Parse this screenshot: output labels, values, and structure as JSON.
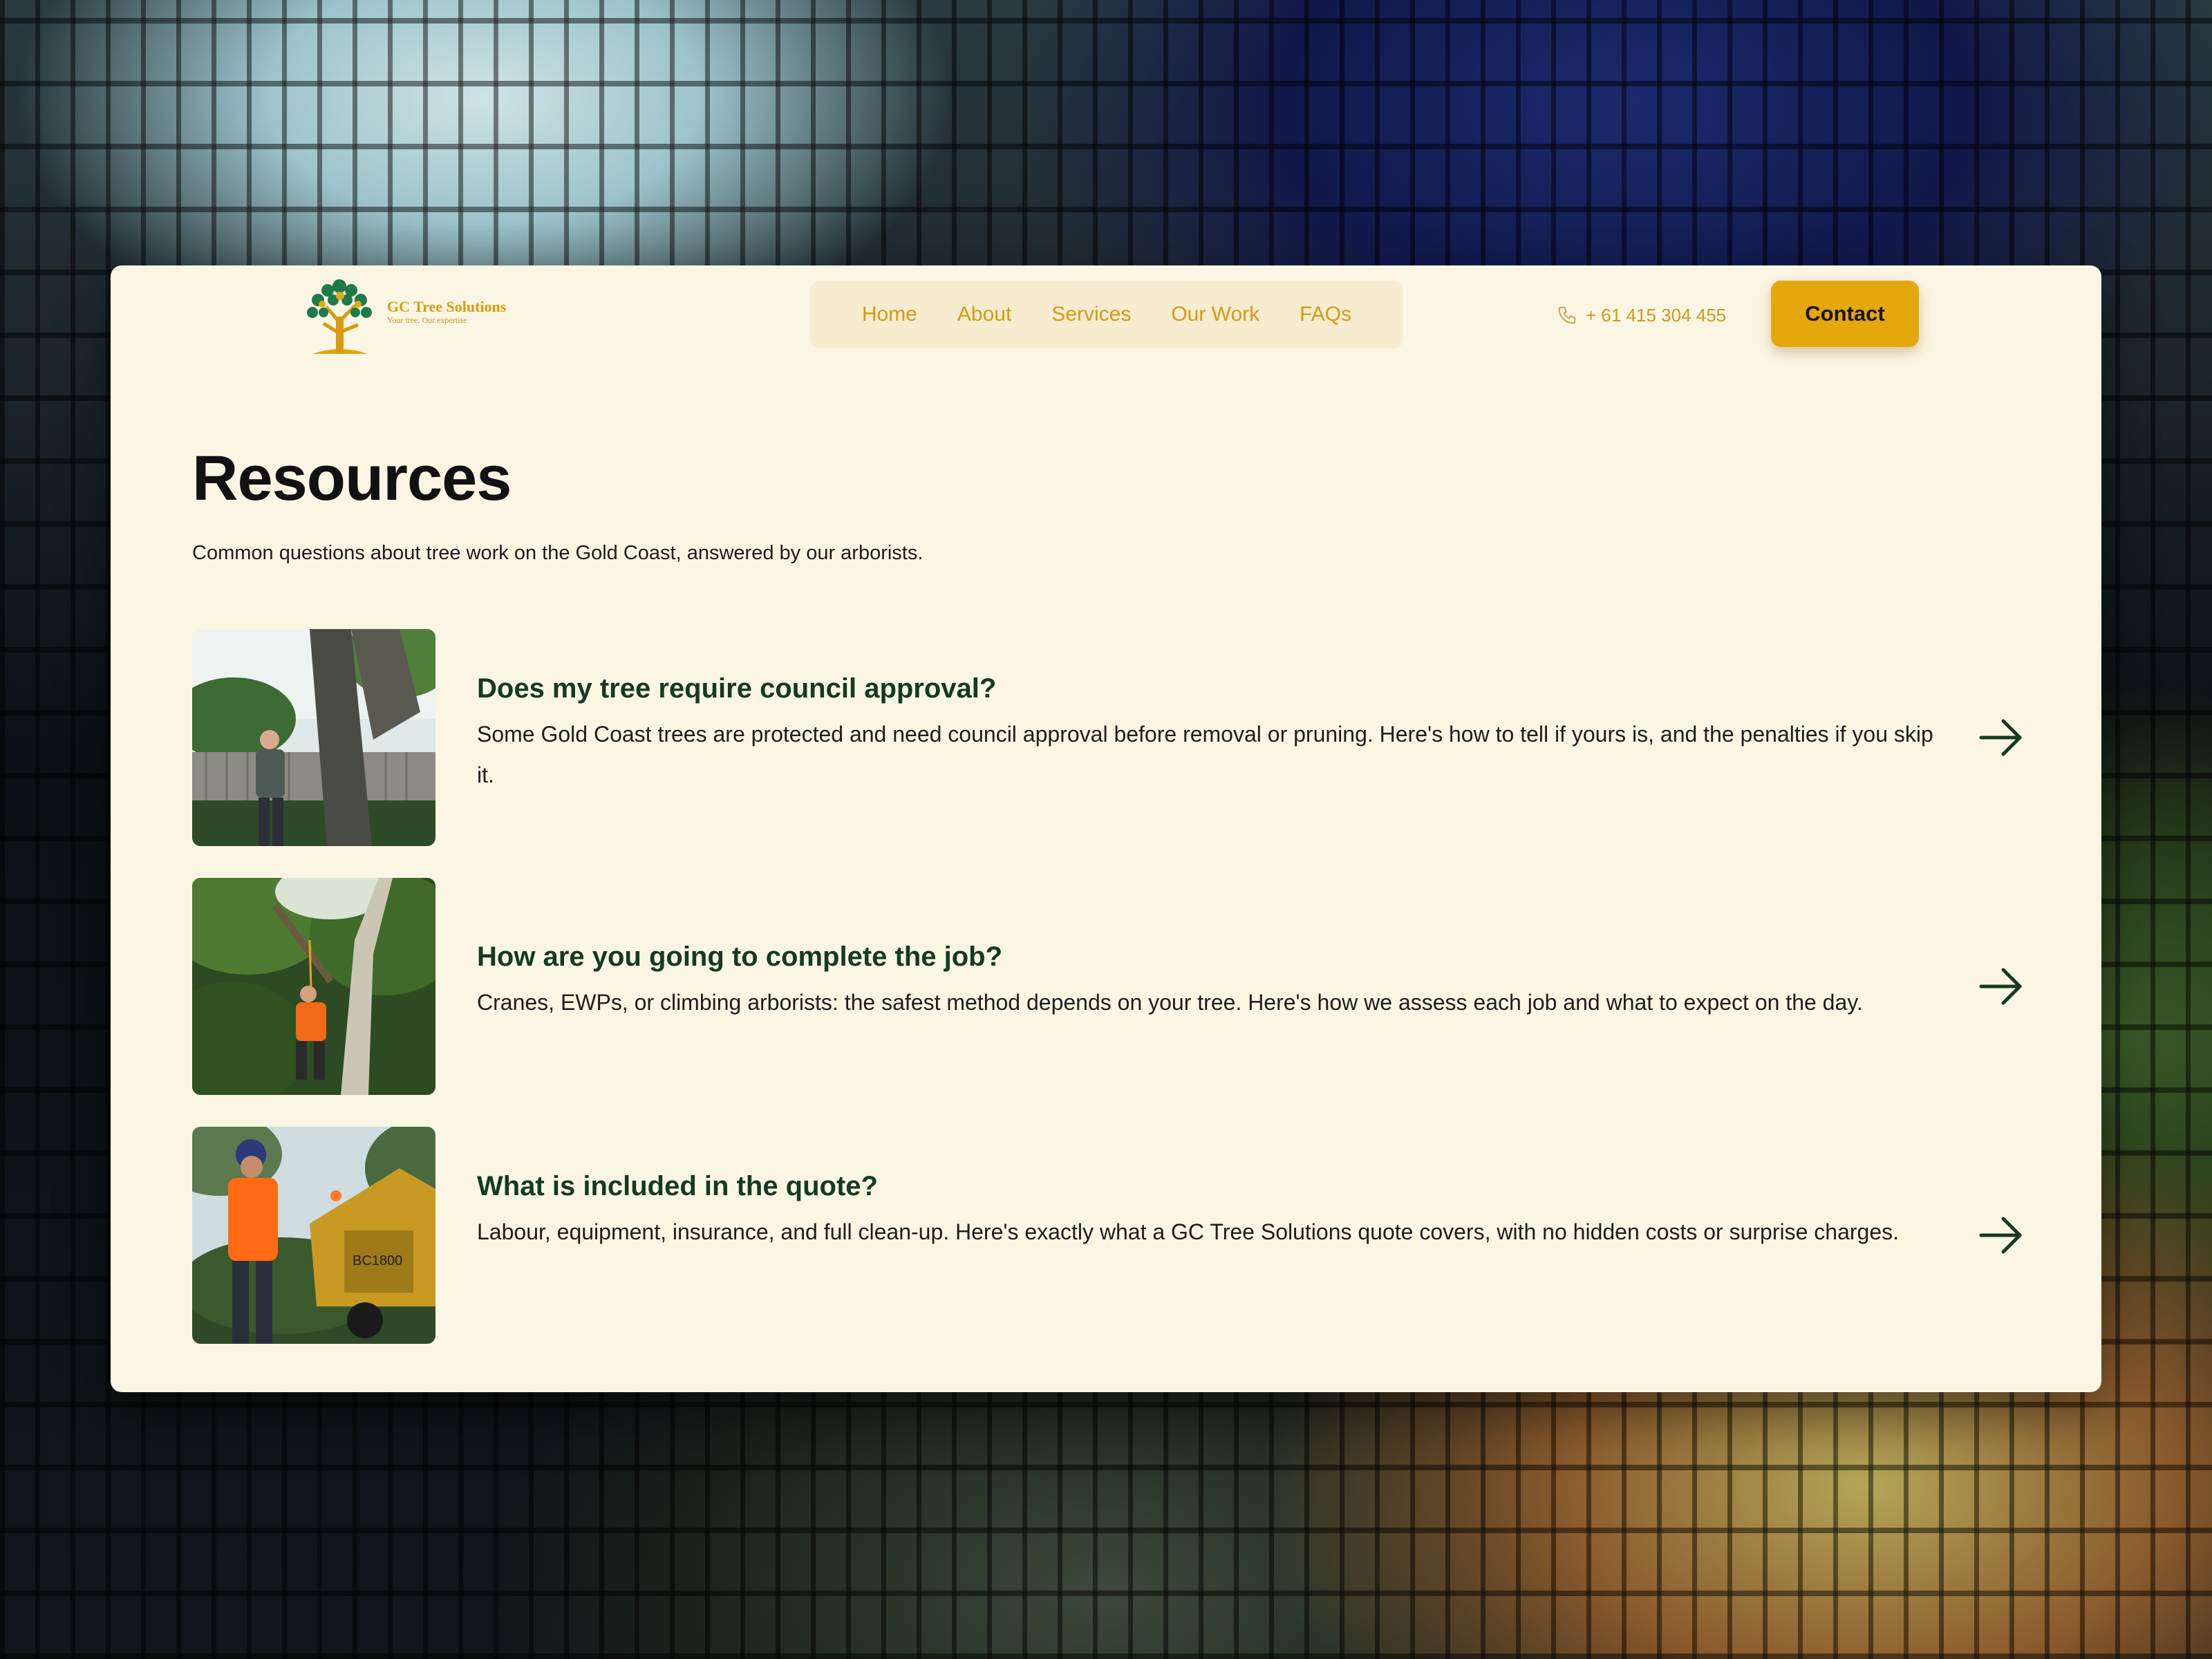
{
  "brand": {
    "name": "GC Tree Solutions",
    "tagline": "Your tree. Our expertise"
  },
  "nav": {
    "items": [
      "Home",
      "About",
      "Services",
      "Our Work",
      "FAQs"
    ]
  },
  "header": {
    "phone": "+ 61 415 304 455",
    "contact_label": "Contact"
  },
  "page": {
    "title": "Resources",
    "subtitle": "Common questions about tree work on the Gold Coast, answered by our arborists."
  },
  "resources": [
    {
      "title": "Does my tree require council approval?",
      "description": "Some Gold Coast trees are protected and need council approval before removal or pruning. Here's how to tell if yours is, and the penalties if you skip it."
    },
    {
      "title": "How are you going to complete the job?",
      "description": "Cranes, EWPs, or climbing arborists: the safest method depends on your tree. Here's how we assess each job and what to expect on the day."
    },
    {
      "title": "What is included in the quote?",
      "description": "Labour, equipment, insurance, and full clean-up. Here's exactly what a GC Tree Solutions quote covers, with no hidden costs or surprise charges."
    }
  ],
  "colors": {
    "card_background": "#fbf5e3",
    "accent": "#e5a80c",
    "nav_text": "#d39a14",
    "heading_green": "#143a22"
  },
  "icons": {
    "phone": "phone-icon",
    "arrow": "arrow-right-icon",
    "logo": "tree-logo-icon"
  }
}
